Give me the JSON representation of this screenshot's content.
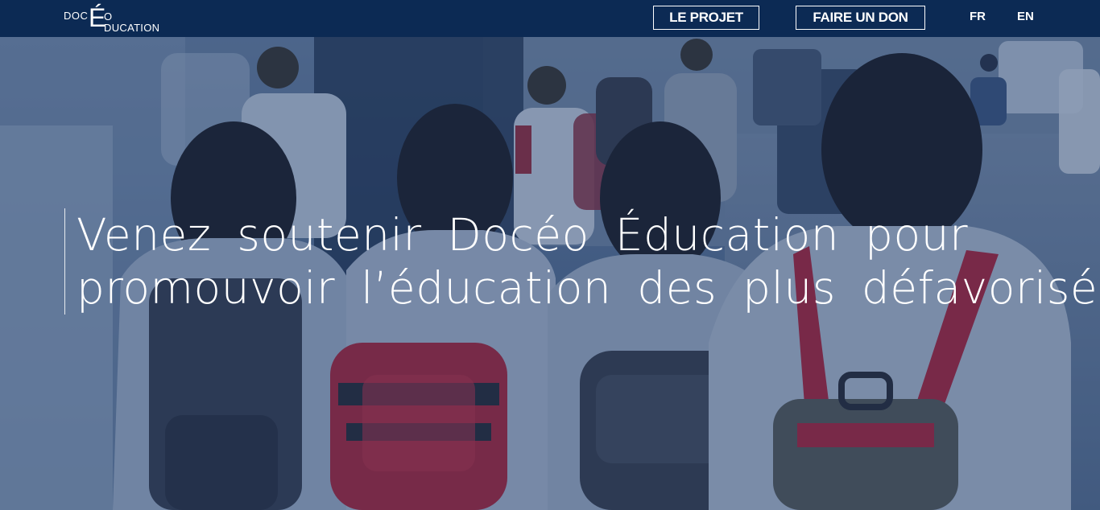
{
  "header": {
    "logo": {
      "doc": "DOC",
      "e_accent": "É",
      "o": "O",
      "ducation": "DUCATION"
    },
    "nav": {
      "projet_label": "LE PROJET",
      "don_label": "FAIRE UN DON"
    },
    "languages": {
      "fr": "FR",
      "en": "EN"
    }
  },
  "hero": {
    "headline_line1": "Venez soutenir Docéo Éducation pour",
    "headline_line2": "promouvoir l’éducation des plus défavorisés."
  },
  "colors": {
    "header_bg": "#0c2a54",
    "overlay": "#14305f",
    "text": "#ffffff",
    "backpack_red": "#c0283a"
  }
}
